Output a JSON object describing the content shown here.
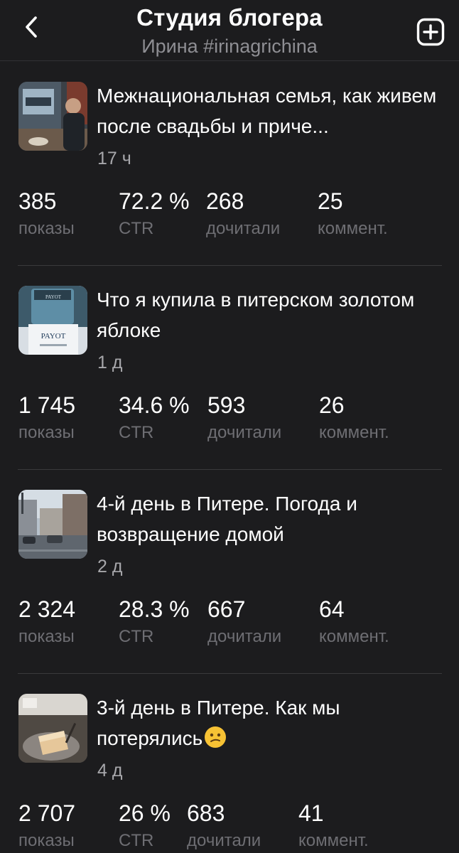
{
  "header": {
    "title": "Студия блогера",
    "subtitle": "Ирина #irinagrichina"
  },
  "icons": {
    "back": "chevron-left-icon",
    "add": "plus-square-icon"
  },
  "colors": {
    "background": "#1c1c1e",
    "primary_text": "#ffffff",
    "secondary_text": "#8e8e93",
    "divider": "#3a3a3c"
  },
  "posts": [
    {
      "title": "Межнациональная семья, как живем после свадьбы и приче...",
      "time": "17 ч",
      "stats": [
        {
          "value": "385",
          "label": "показы"
        },
        {
          "value": "72.2 %",
          "label": "CTR"
        },
        {
          "value": "268",
          "label": "дочитали"
        },
        {
          "value": "25",
          "label": "коммент."
        }
      ]
    },
    {
      "title": "Что я купила в питерском золотом яблоке",
      "time": "1 д",
      "stats": [
        {
          "value": "1 745",
          "label": "показы"
        },
        {
          "value": "34.6 %",
          "label": "CTR"
        },
        {
          "value": "593",
          "label": "дочитали"
        },
        {
          "value": "26",
          "label": "коммент."
        }
      ]
    },
    {
      "title": "4-й день в Питере. Погода и возвращение домой",
      "time": "2 д",
      "stats": [
        {
          "value": "2 324",
          "label": "показы"
        },
        {
          "value": "28.3 %",
          "label": "CTR"
        },
        {
          "value": "667",
          "label": "дочитали"
        },
        {
          "value": "64",
          "label": "коммент."
        }
      ]
    },
    {
      "title": "3-й день в Питере. Как мы потерялись",
      "title_emoji": "confused-face-emoji",
      "time": "4 д",
      "stats": [
        {
          "value": "2 707",
          "label": "показы"
        },
        {
          "value": "26 %",
          "label": "CTR"
        },
        {
          "value": "683",
          "label": "дочитали"
        },
        {
          "value": "41",
          "label": "коммент."
        }
      ]
    }
  ]
}
